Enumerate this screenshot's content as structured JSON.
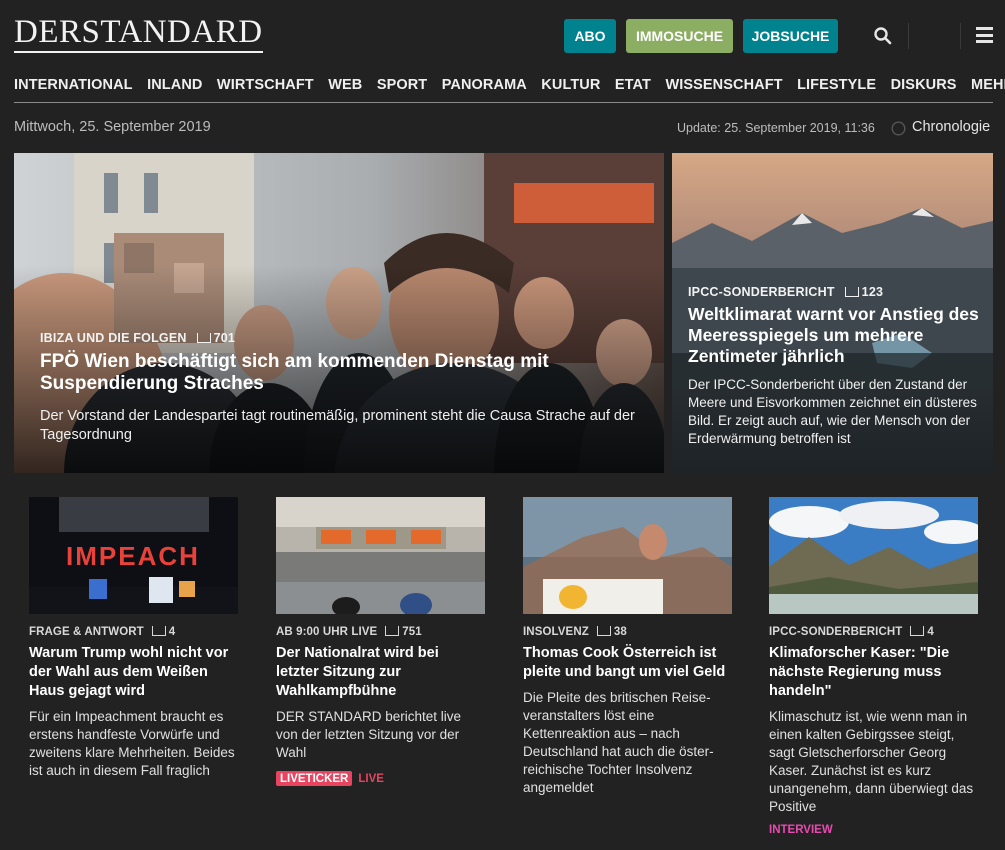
{
  "header": {
    "logo_text": "DERSTANDARD",
    "buttons": {
      "abo": "ABO",
      "immosuche": "IMMOSUCHE",
      "jobsuche": "JOBSUCHE"
    },
    "icons": {
      "search": "search-icon",
      "menu": "menu-icon"
    }
  },
  "nav": {
    "items": [
      "INTERNATIONAL",
      "INLAND",
      "WIRTSCHAFT",
      "WEB",
      "SPORT",
      "PANORAMA",
      "KULTUR",
      "ETAT",
      "WISSENSCHAFT",
      "LIFESTYLE",
      "DISKURS",
      "MEHR …"
    ]
  },
  "dateline": {
    "date": "Mittwoch, 25. September 2019",
    "update": "Update: 25. September 2019, 11:36",
    "chronologie": "Chronologie"
  },
  "hero_main": {
    "kicker": "IBIZA UND DIE FOLGEN",
    "comments": "701",
    "title": "FPÖ Wien beschäftigt sich am kommenden Dienstag mit Suspendierung Straches",
    "subtitle": "Der Vorstand der Landespartei tagt routinemäßig, prominent steht die Causa Strache auf der Tagesordnung"
  },
  "hero_side": {
    "kicker": "IPCC-SONDERBERICHT",
    "comments": "123",
    "title": "Weltklimarat warnt vor Anstieg des Meeresspiegels um mehrere Zentimeter jährlich",
    "subtitle": "Der IPCC-Sonderbericht über den Zustand der Meere und Eisvorkommen zeichnet ein düsteres Bild. Er zeigt auch auf, wie der Mensch von der Erderwärmung betroffen ist"
  },
  "cards": [
    {
      "kicker": "FRAGE & ANTWORT",
      "comments": "4",
      "title": "Warum Trump wohl nicht vor der Wahl aus dem Weißen Haus gejagt wird",
      "subtitle": "Für ein Impeachment braucht es erstens handfeste Vorwürfe und zweitens klare Mehrheiten. Beides ist auch in diesem Fall fraglich",
      "image_text": "IMPEACH"
    },
    {
      "kicker": "AB 9:00 UHR LIVE",
      "comments": "751",
      "title": "Der Nationalrat wird bei letzter Sitzung zur Wahlkampfbühne",
      "subtitle": "DER STANDARD berichtet live von der letzten Sitzung vor der Wahl",
      "badge": "LIVETICKER",
      "live": "LIVE"
    },
    {
      "kicker": "INSOLVENZ",
      "comments": "38",
      "title": "Thomas Cook Österreich ist pleite und bangt um viel Geld",
      "subtitle": "Die Pleite des britischen Reise­veranstalters löst eine Kettenreaktion aus – nach Deutschland hat auch die öster­reichische Tochter Insolvenz angemeldet"
    },
    {
      "kicker": "IPCC-SONDERBERICHT",
      "comments": "4",
      "title": "Klimaforscher Kaser: \"Die nächste Regierung muss handeln\"",
      "subtitle": "Klimaschutz ist, wie wenn man in einen kalten Gebirgssee steigt, sagt Gletscherforscher Georg Kaser. Zunächst ist es kurz unangenehm, dann überwiegt das Positive",
      "label": "INTERVIEW"
    }
  ],
  "colors": {
    "background": "#222222",
    "teal": "#00838f",
    "green": "#8bae62",
    "live_red": "#e84460",
    "interview_pink": "#e84ab0"
  }
}
